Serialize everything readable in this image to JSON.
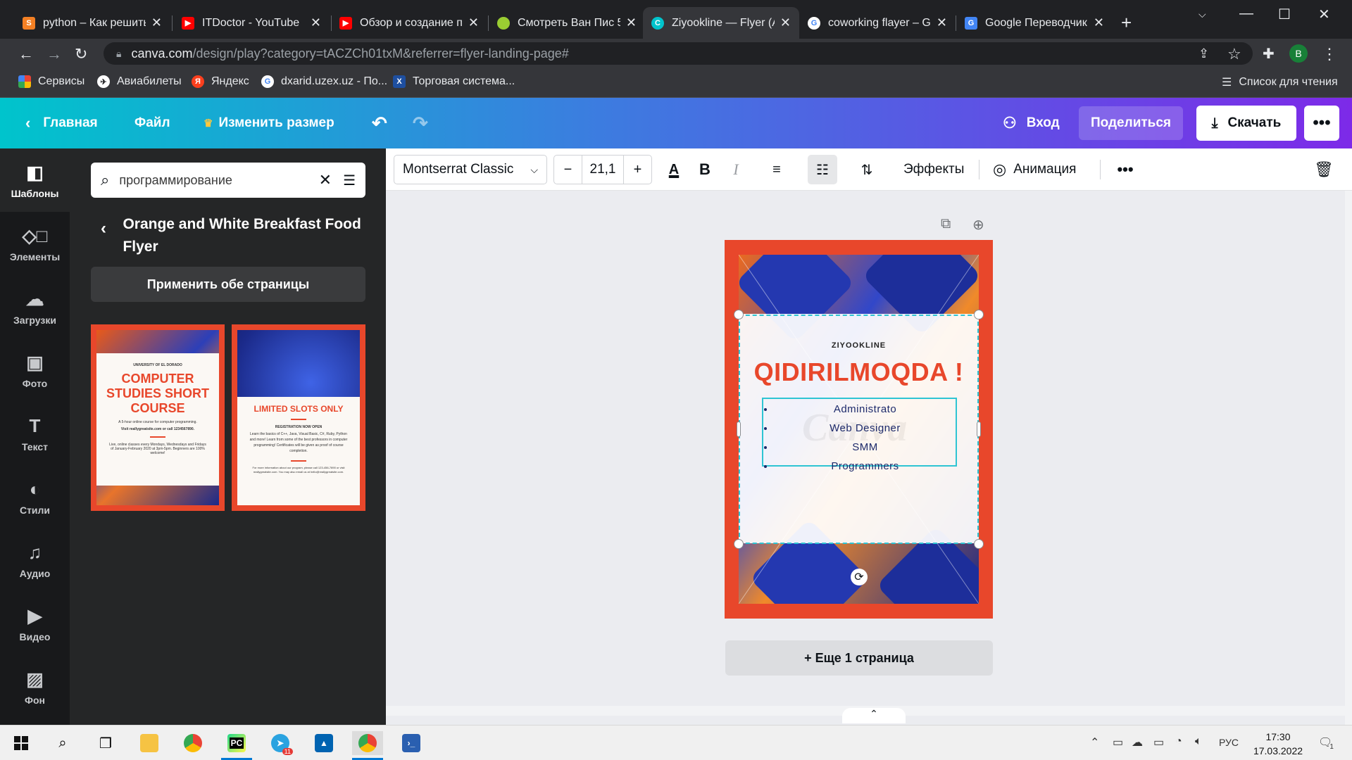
{
  "browser": {
    "tabs": [
      {
        "title": "python – Как решить",
        "icon": "stackoverflow-icon",
        "color": "#f48024"
      },
      {
        "title": "ITDoctor - YouTube",
        "icon": "youtube-icon",
        "color": "#ff0000"
      },
      {
        "title": "Обзор и создание п",
        "icon": "youtube-icon",
        "color": "#ff0000"
      },
      {
        "title": "Смотреть Ван Пис 5(",
        "icon": "site-icon",
        "color": "#9acd32"
      },
      {
        "title": "Ziyookline — Flyer (A",
        "icon": "canva-icon",
        "color": "#00c4cc"
      },
      {
        "title": "coworking flayer – Go",
        "icon": "google-icon",
        "color": "#ffffff"
      },
      {
        "title": "Google Переводчик",
        "icon": "translate-icon",
        "color": "#4285f4"
      }
    ],
    "url_host": "canva.com",
    "url_path": "/design/play?category=tACZCh01txM&referrer=flyer-landing-page#",
    "profile_initial": "B",
    "bookmarks": [
      {
        "label": "Сервисы",
        "icon": "apps-icon"
      },
      {
        "label": "Авиабилеты",
        "icon": "plane-icon"
      },
      {
        "label": "Яндекс",
        "icon": "yandex-icon"
      },
      {
        "label": "dxarid.uzex.uz - По...",
        "icon": "google-icon"
      },
      {
        "label": "Торговая система...",
        "icon": "uzex-icon"
      }
    ],
    "reading_list": "Список для чтения"
  },
  "canva_header": {
    "home": "Главная",
    "file": "Файл",
    "resize": "Изменить размер",
    "login": "Вход",
    "share": "Поделиться",
    "download": "Скачать"
  },
  "rail": [
    {
      "label": "Шаблоны",
      "icon": "templates-icon"
    },
    {
      "label": "Элементы",
      "icon": "elements-icon"
    },
    {
      "label": "Загрузки",
      "icon": "upload-icon"
    },
    {
      "label": "Фото",
      "icon": "photo-icon"
    },
    {
      "label": "Текст",
      "icon": "text-icon"
    },
    {
      "label": "Стили",
      "icon": "styles-icon"
    },
    {
      "label": "Аудио",
      "icon": "audio-icon"
    },
    {
      "label": "Видео",
      "icon": "video-icon"
    },
    {
      "label": "Фон",
      "icon": "background-icon"
    }
  ],
  "panel": {
    "search_value": "программирование",
    "template_title": "Orange and White Breakfast Food Flyer",
    "apply_label": "Применить обе страницы",
    "thumb1": {
      "university": "UNIVERSITY OF EL DORADO",
      "title": "COMPUTER STUDIES SHORT COURSE",
      "line1": "A 5-hour online course for computer programming.",
      "line2": "Visit reallygreatsite.com or call 1234567890.",
      "line3": "Live, online classes every Mondays, Wednesdays and Fridays of January-February 2020 at 3pm-5pm. Beginners are 100% welcome!"
    },
    "thumb2": {
      "title": "LIMITED SLOTS ONLY",
      "subtitle": "REGISTRATION NOW OPEN",
      "body": "Learn the basics of C++, Java, Visual Basic, C#, Ruby, Python and more! Learn from some of the best professors in computer programming! Certificates will be given as proof of course completion.",
      "footer": "For more information about our program, please call 123-456-7890 or visit reallygreatsite.com. You may also email us at hello@reallygreatsite.com."
    }
  },
  "toolbar": {
    "font": "Montserrat Classic",
    "size": "21,1",
    "effects": "Эффекты",
    "animation": "Анимация"
  },
  "canvas": {
    "brand": "ZIYOOKLINE",
    "headline": "QIDIRILMOQDA !",
    "list": [
      "Administrato",
      "Web Designer",
      "SMM",
      "Programmers"
    ],
    "watermark": "Canva",
    "add_page": "+ Еще 1 страница",
    "accent": "#e8472b",
    "selection": "#2ec4d3"
  },
  "taskbar": {
    "lang": "РУС",
    "time": "17:30",
    "date": "17.03.2022",
    "notif_count": "1",
    "telegram_badge": "11"
  }
}
